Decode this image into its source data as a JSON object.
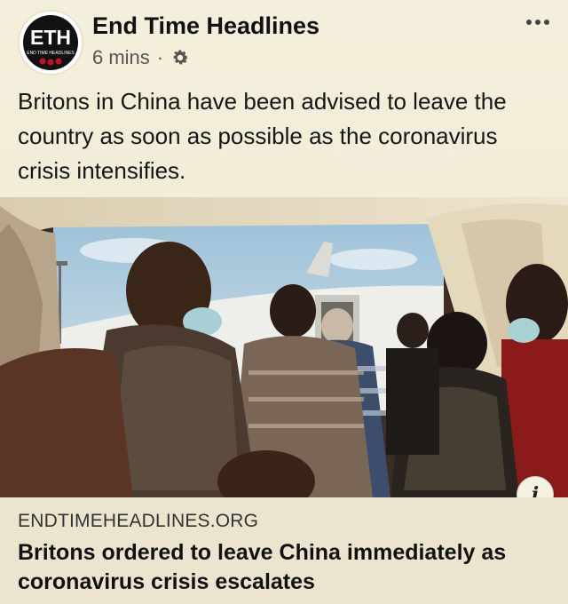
{
  "post": {
    "page_name": "End Time Headlines",
    "avatar": {
      "initials": "ETH",
      "caption": "END TIME HEADLINES"
    },
    "timestamp": "6 mins",
    "separator": "·",
    "privacy_icon": "gear-icon",
    "more_icon": "more-options-icon",
    "text": "Britons in China have been advised to leave the country as soon as possible as the coronavirus crisis intensifies."
  },
  "link_card": {
    "domain": "ENDTIMEHEADLINES.ORG",
    "title": "Britons ordered to leave China immediately as coronavirus crisis escalates",
    "info_label": "i"
  },
  "colors": {
    "background": "#f1ecd8",
    "logo_red": "#c8102e",
    "logo_black": "#111111"
  }
}
